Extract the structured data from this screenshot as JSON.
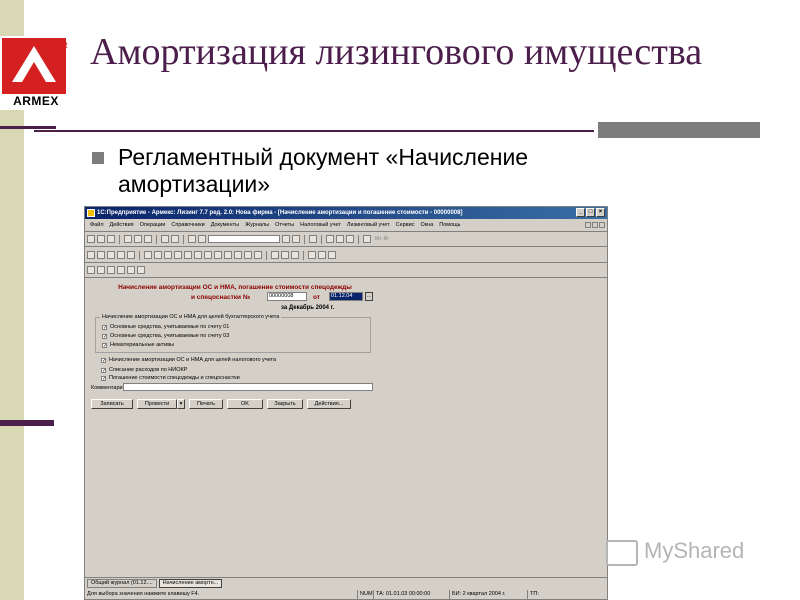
{
  "slide": {
    "logo_text": "ARMEX",
    "logo_mark": "R",
    "title": "Амортизация лизингового имущества",
    "bullet": "Регламентный документ «Начисление амортизации»",
    "watermark": "MyShared"
  },
  "window": {
    "title": "1С:Предприятие - Армекс: Лизинг 7.7 ред. 2.0: Нова фирма - [Начисление амортизации и погашение стоимости - 00000008]",
    "menu": [
      "Файл",
      "Действия",
      "Операции",
      "Справочники",
      "Документы",
      "Журналы",
      "Отчеты",
      "Налоговый учет",
      "Лизинговый учет",
      "Сервис",
      "Окна",
      "Помощь"
    ],
    "toolbar_text": "М+ М-"
  },
  "form": {
    "heading_line1": "Начисление амортизации ОС и НМА, погашение стоимости спецодежды",
    "heading_line2": "и спецоснастки №",
    "number": "00000008",
    "from_label": "от",
    "date": "01.12.04",
    "period": "за Декабрь 2004 г.",
    "group_title": "Начисление амортизации ОС и НМА для целей бухгалтерского учета",
    "group_items": [
      "Основные средства, учитываемые по счету 01",
      "Основные средства, учитываемые по счету 03",
      "Нематериальные активы"
    ],
    "tax_option": "Начисление амортизации ОС и НМА для целей налогового учета",
    "niokr_option": "Списание расходов по НИОКР",
    "uniform_option": "Погашение стоимости спецодежды и спецоснастки",
    "comment_label": "Комментарий:",
    "comment_value": "",
    "buttons": [
      "Записать",
      "Провести",
      "Печать",
      "OK",
      "Закрыть",
      "Действия..."
    ]
  },
  "taskbar": {
    "items": [
      "Общий журнал (01.12....",
      "Начисление амортн..."
    ]
  },
  "statusbar": {
    "hint": "Для выбора значения нажмите клавишу F4.",
    "num": "NUM",
    "ta": "ТА: 01.01.03 00:00:00",
    "bi": "БИ: 2 квартал 2004 г.",
    "tp": "ТП:"
  }
}
